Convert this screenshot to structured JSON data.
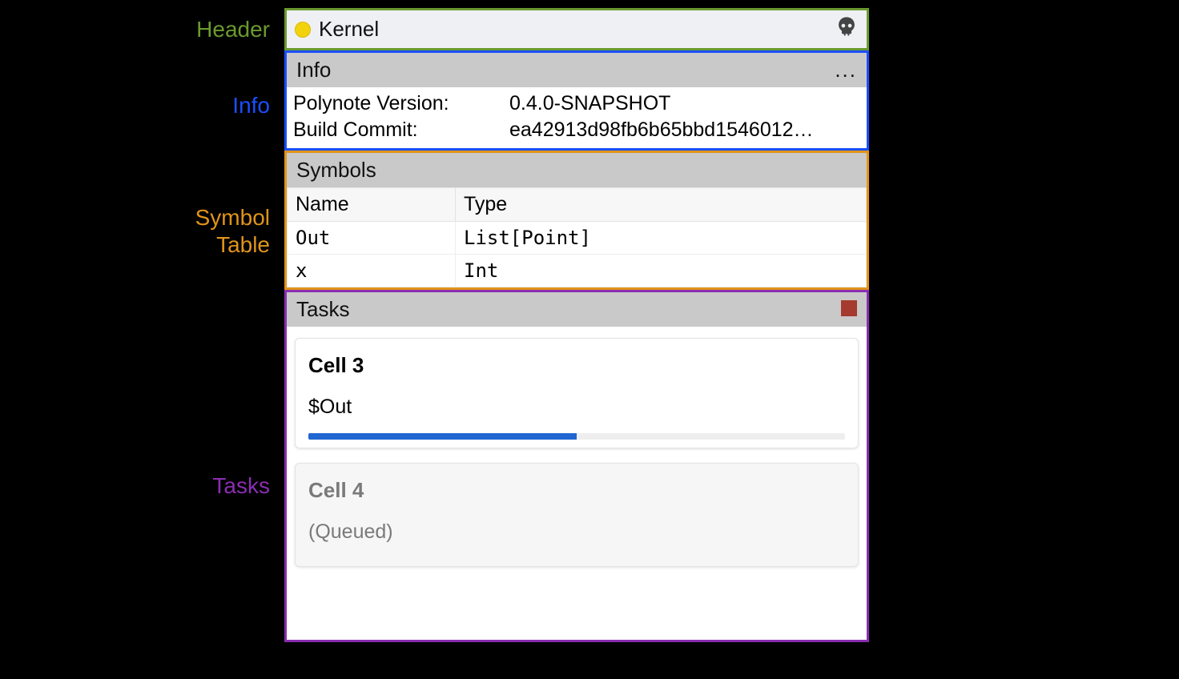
{
  "annotations": {
    "header": "Header",
    "info": "Info",
    "symbols": "Symbol\nTable",
    "tasks": "Tasks"
  },
  "colors": {
    "header_border": "#6a9a2f",
    "info_border": "#1a4fff",
    "symbols_border": "#e0941a",
    "tasks_border": "#8a2db0",
    "status_dot": "#f2d20c",
    "progress": "#2166d1",
    "stop": "#a53a2e"
  },
  "header": {
    "title": "Kernel",
    "status": "busy",
    "action_icon": "skull-icon"
  },
  "info": {
    "title": "Info",
    "menu_label": "...",
    "rows": [
      {
        "key": "Polynote Version:",
        "value": "0.4.0-SNAPSHOT"
      },
      {
        "key": "Build Commit:",
        "value": "ea42913d98fb6b65bbd1546012…"
      }
    ]
  },
  "symbols": {
    "title": "Symbols",
    "columns": [
      "Name",
      "Type"
    ],
    "rows": [
      {
        "name": "Out",
        "type": "List[Point]"
      },
      {
        "name": "x",
        "type": "Int"
      }
    ]
  },
  "tasks": {
    "title": "Tasks",
    "stop_icon": "stop-icon",
    "items": [
      {
        "title": "Cell 3",
        "subtitle": "$Out",
        "state": "running",
        "progress": 50
      },
      {
        "title": "Cell 4",
        "subtitle": "(Queued)",
        "state": "queued",
        "progress": 0
      }
    ]
  }
}
